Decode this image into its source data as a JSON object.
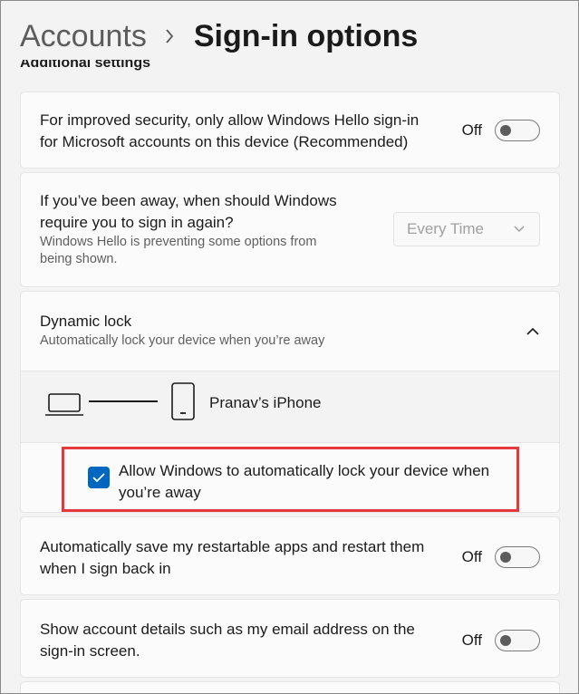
{
  "breadcrumb": {
    "parent": "Accounts",
    "current": "Sign-in options"
  },
  "section": {
    "heading": "Additional settings"
  },
  "settings": {
    "hello_only": {
      "line1": "For improved security, only allow Windows Hello sign-in",
      "line2": "for Microsoft accounts on this device (Recommended)",
      "state": "Off"
    },
    "require_signin": {
      "line1": "If you’ve been away, when should Windows",
      "line2": "require you to sign in again?",
      "sub1": "Windows Hello is preventing some options from",
      "sub2": "being shown.",
      "dropdown_value": "Every Time"
    },
    "dynamic_lock": {
      "title": "Dynamic lock",
      "subtitle": "Automatically lock your device when you’re away",
      "device_name": "Pranav’s iPhone",
      "checkbox_line1": "Allow Windows to automatically lock your device when",
      "checkbox_line2": "you’re away",
      "checked": true
    },
    "restart_apps": {
      "line1": "Automatically save my restartable apps and restart them",
      "line2": "when I sign back in",
      "state": "Off"
    },
    "account_details": {
      "line1": "Show account details such as my email address on the",
      "line2": "sign-in screen.",
      "state": "Off"
    }
  },
  "colors": {
    "accent": "#0067c0",
    "highlight_border": "#e5383e",
    "background": "#f3f3f3",
    "card": "#fbfbfb"
  },
  "icons": [
    "chevron-right-icon",
    "chevron-down-icon",
    "chevron-up-icon",
    "laptop-icon",
    "phone-icon",
    "checkmark-icon"
  ]
}
